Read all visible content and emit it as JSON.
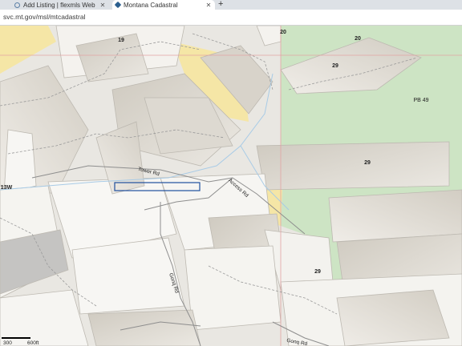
{
  "browser": {
    "tabs": [
      {
        "title": "Add Listing | flexmls Web",
        "active": false
      },
      {
        "title": "Montana Cadastral",
        "active": true
      }
    ],
    "url": "svc.mt.gov/msl/mtcadastral"
  },
  "map": {
    "section_labels": [
      "19",
      "20",
      "20",
      "29",
      "PB 49",
      "29",
      "13W",
      "29"
    ],
    "road_labels": [
      "Tower Rd",
      "Access Rd",
      "Gonq Rd",
      "Gonq Rd"
    ],
    "scale": {
      "start": "300",
      "end": "600ft"
    },
    "colors": {
      "background": "#e7e5e0",
      "parcel": "#f7f6f3",
      "forest": "#cde4c4",
      "yellow": "#f5e6a6",
      "water": "#b9d6ea",
      "highlight": "#1f4f9e"
    }
  }
}
